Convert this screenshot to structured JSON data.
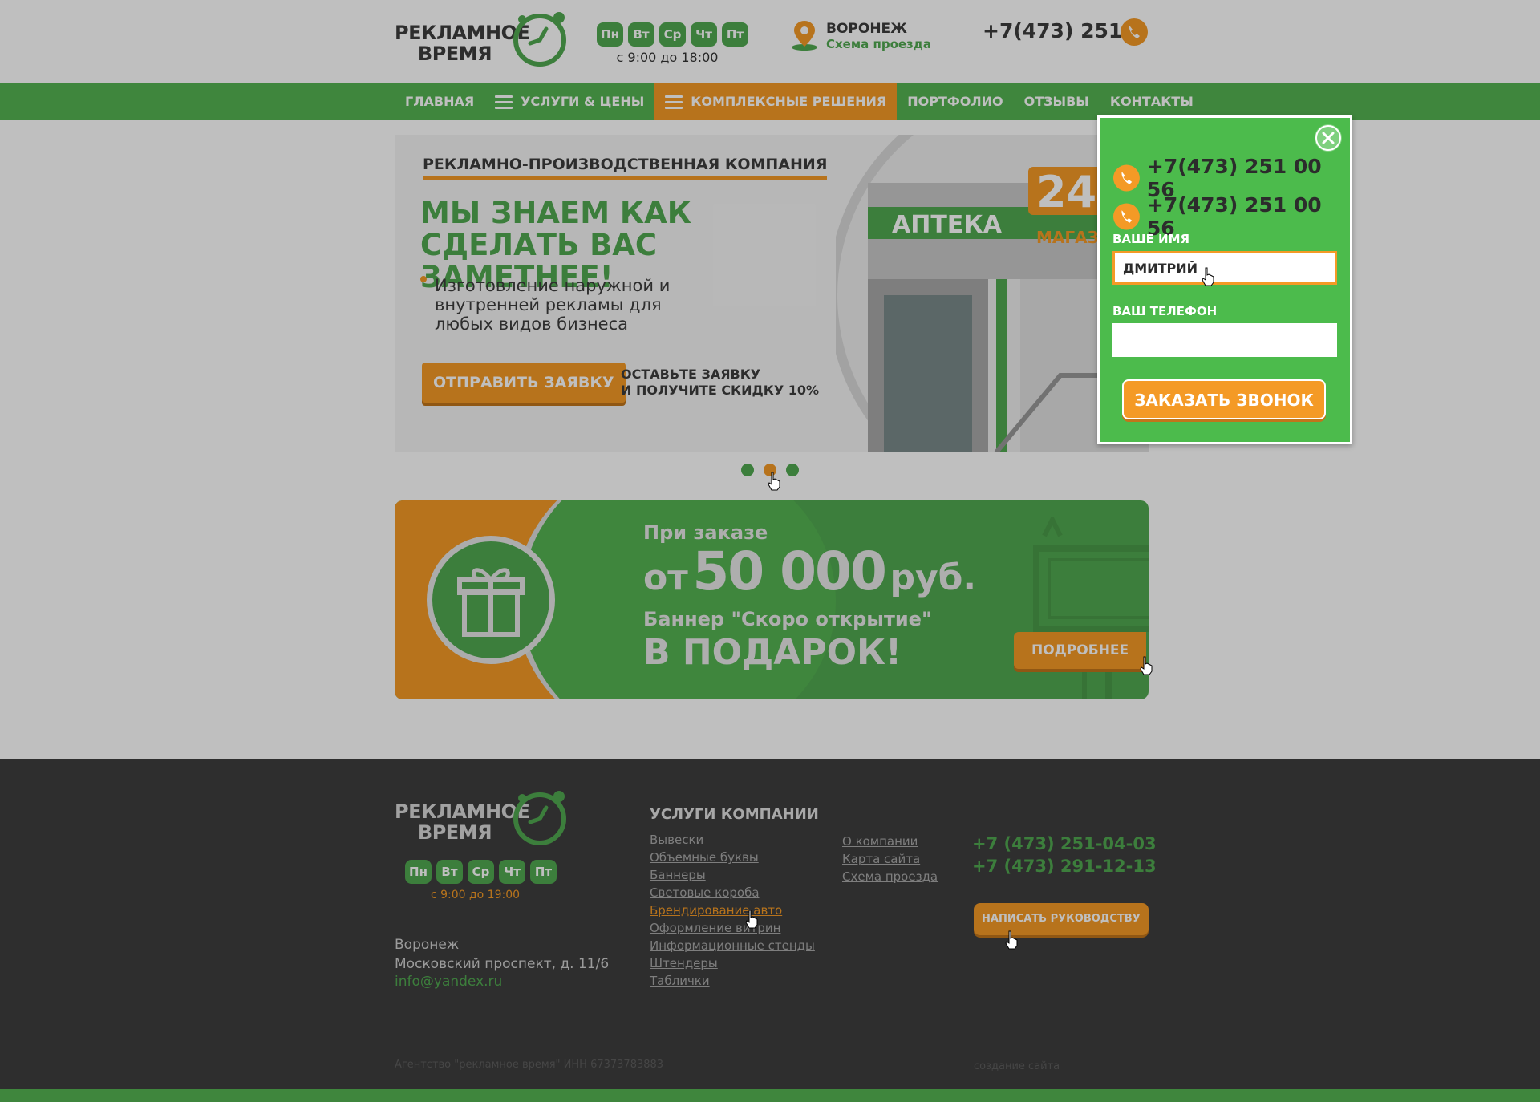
{
  "colors": {
    "green": "#51a850",
    "orange": "#f49a26",
    "dark": "#3e3e3e"
  },
  "header": {
    "logo_line1": "РЕКЛАМНОЕ",
    "logo_line2": "ВРЕМЯ",
    "days": [
      "Пн",
      "Вт",
      "Ср",
      "Чт",
      "Пт"
    ],
    "hours": "с 9:00 до 18:00",
    "city": "ВОРОНЕЖ",
    "city_link": "Схема проезда",
    "phone": "+7(473) 251 .."
  },
  "nav": {
    "items": [
      {
        "label": "ГЛАВНАЯ"
      },
      {
        "label": "УСЛУГИ & ЦЕНЫ"
      },
      {
        "label": "КОМПЛЕКСНЫЕ РЕШЕНИЯ"
      },
      {
        "label": "ПОРТФОЛИО"
      },
      {
        "label": "ОТЗЫВЫ"
      },
      {
        "label": "КОНТАКТЫ"
      }
    ]
  },
  "hero": {
    "kicker": "РЕКЛАМНО-ПРОИЗВОДСТВЕННАЯ КОМПАНИЯ",
    "title": "МЫ ЗНАЕМ КАК СДЕЛАТЬ ВАС ЗАМЕТНЕЕ!",
    "desc": "Изготовление наружной и внутренней рекламы для любых видов бизнеса",
    "button": "ОТПРАВИТЬ ЗАЯВКУ",
    "note_line1": "ОСТАВЬТЕ ЗАЯВКУ",
    "note_line2": "И ПОЛУЧИТЕ СКИДКУ 10%",
    "sign_number": "24",
    "sign_text1": "АПТЕКА",
    "sign_text2": "МАГАЗИН"
  },
  "promo": {
    "line1": "При заказе",
    "amount_prefix": "от",
    "amount": "50 000",
    "amount_suffix": "руб.",
    "line3": "Баннер \"Скоро открытие\"",
    "line4": "В ПОДАРОК!",
    "button": "ПОДРОБНЕЕ"
  },
  "footer": {
    "logo_line1": "РЕКЛАМНОЕ",
    "logo_line2": "ВРЕМЯ",
    "days": [
      "Пн",
      "Вт",
      "Ср",
      "Чт",
      "Пт"
    ],
    "hours": "с 9:00 до 19:00",
    "city": "Воронеж",
    "address": "Московский проспект, д. 11/6",
    "email": "info@yandex.ru",
    "services_title": "УСЛУГИ КОМПАНИИ",
    "services": [
      "Вывески",
      "Объемные буквы",
      "Баннеры",
      "Световые короба",
      "Брендирование авто",
      "Оформление витрин",
      "Информационные стенды",
      "Штендеры",
      "Таблички"
    ],
    "links": [
      "О компании",
      "Карта сайта",
      "Схема проезда"
    ],
    "phones": [
      "+7 (473) 251-04-03",
      "+7 (473) 291-12-13"
    ],
    "button": "НАПИСАТЬ РУКОВОДСТВУ",
    "copyright": "Агентство \"рекламное время\"   ИНН 67373783883",
    "dev": "создание сайта"
  },
  "modal": {
    "phones": [
      "+7(473) 251 00 56",
      "+7(473) 251 00 56"
    ],
    "name_label": "ВАШЕ ИМЯ",
    "name_value": "ДМИТРИЙ",
    "phone_label": "ВАШ ТЕЛЕФОН",
    "phone_value": "",
    "submit": "ЗАКАЗАТЬ ЗВОНОК"
  }
}
